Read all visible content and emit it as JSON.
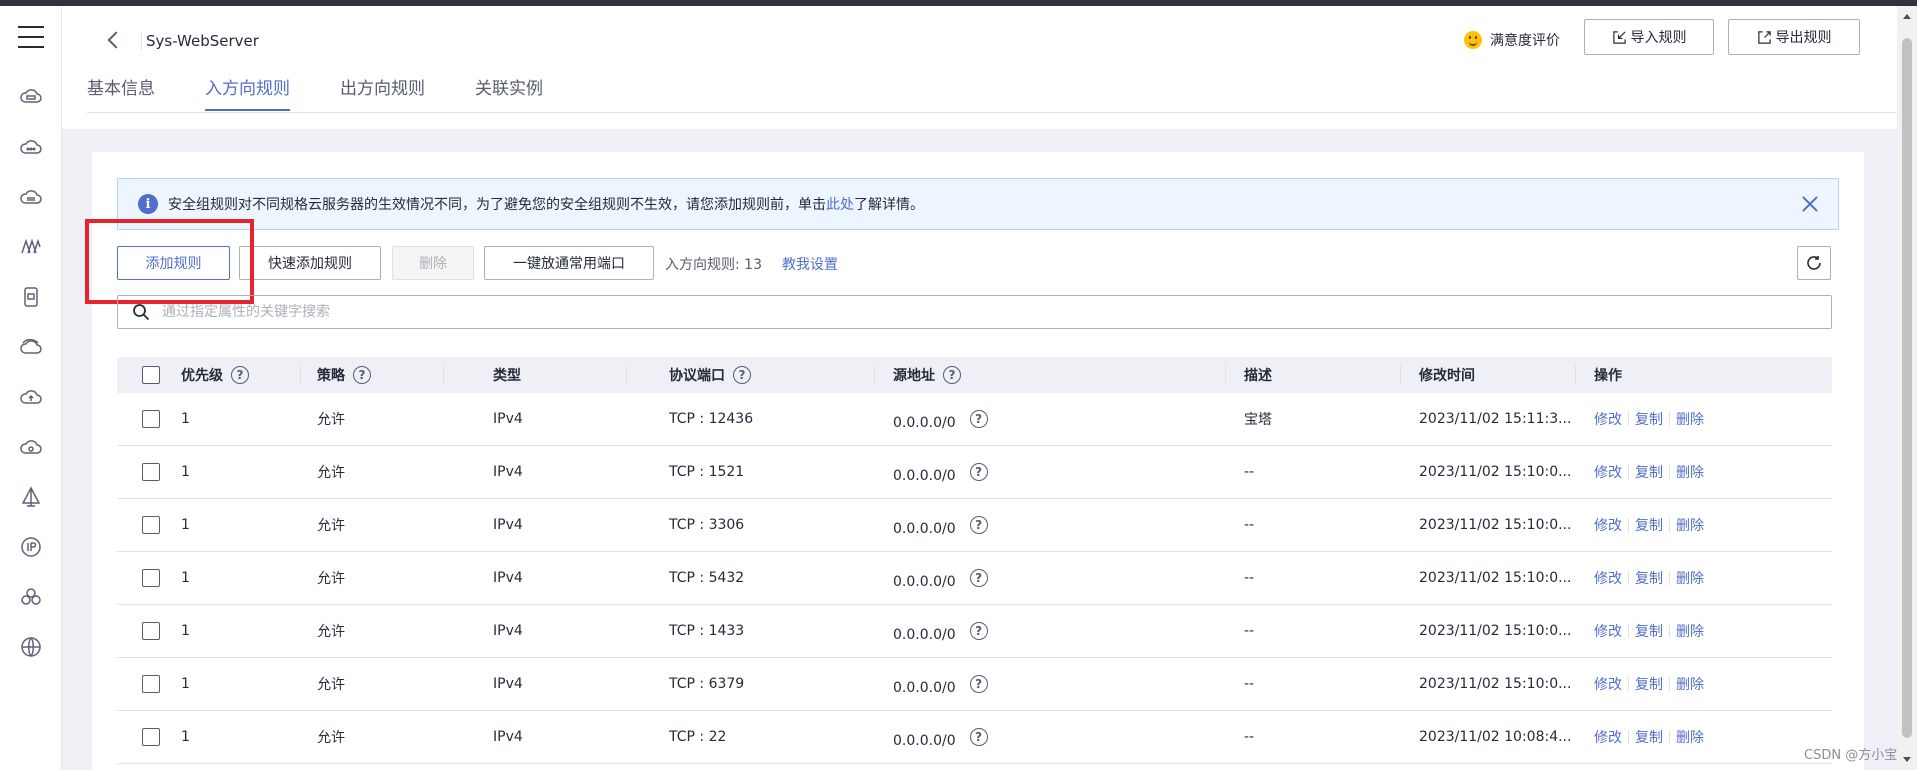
{
  "header": {
    "title": "Sys-WebServer",
    "satisfaction_label": "满意度评价",
    "import_label": "导入规则",
    "export_label": "导出规则"
  },
  "tabs": [
    {
      "label": "基本信息",
      "active": false
    },
    {
      "label": "入方向规则",
      "active": true
    },
    {
      "label": "出方向规则",
      "active": false
    },
    {
      "label": "关联实例",
      "active": false
    }
  ],
  "alert": {
    "text_before": "安全组规则对不同规格云服务器的生效情况不同，为了避免您的安全组规则不生效，请您添加规则前，单击",
    "link": "此处",
    "text_after": "了解详情。"
  },
  "toolbar": {
    "add_rule": "添加规则",
    "quick_add": "快速添加规则",
    "delete": "删除",
    "open_common_ports": "一键放通常用端口",
    "rule_count_label": "入方向规则: 13",
    "help_link": "教我设置"
  },
  "search": {
    "placeholder": "通过指定属性的关键字搜索"
  },
  "table": {
    "columns": {
      "priority": "优先级",
      "policy": "策略",
      "type": "类型",
      "protocol_port": "协议端口",
      "source": "源地址",
      "description": "描述",
      "modified": "修改时间",
      "actions": "操作"
    },
    "rows": [
      {
        "priority": "1",
        "policy": "允许",
        "type": "IPv4",
        "port": "TCP : 12436",
        "source": "0.0.0.0/0",
        "description": "宝塔",
        "modified": "2023/11/02 15:11:3..."
      },
      {
        "priority": "1",
        "policy": "允许",
        "type": "IPv4",
        "port": "TCP : 1521",
        "source": "0.0.0.0/0",
        "description": "--",
        "modified": "2023/11/02 15:10:0..."
      },
      {
        "priority": "1",
        "policy": "允许",
        "type": "IPv4",
        "port": "TCP : 3306",
        "source": "0.0.0.0/0",
        "description": "--",
        "modified": "2023/11/02 15:10:0..."
      },
      {
        "priority": "1",
        "policy": "允许",
        "type": "IPv4",
        "port": "TCP : 5432",
        "source": "0.0.0.0/0",
        "description": "--",
        "modified": "2023/11/02 15:10:0..."
      },
      {
        "priority": "1",
        "policy": "允许",
        "type": "IPv4",
        "port": "TCP : 1433",
        "source": "0.0.0.0/0",
        "description": "--",
        "modified": "2023/11/02 15:10:0..."
      },
      {
        "priority": "1",
        "policy": "允许",
        "type": "IPv4",
        "port": "TCP : 6379",
        "source": "0.0.0.0/0",
        "description": "--",
        "modified": "2023/11/02 15:10:0..."
      },
      {
        "priority": "1",
        "policy": "允许",
        "type": "IPv4",
        "port": "TCP : 22",
        "source": "0.0.0.0/0",
        "description": "--",
        "modified": "2023/11/02 10:08:4..."
      }
    ],
    "actions": {
      "edit": "修改",
      "copy": "复制",
      "delete": "删除"
    }
  },
  "sidebar_icons": [
    "cloud-server-icon",
    "cloud-icon",
    "storage-icon",
    "network-icon",
    "device-icon",
    "cloud-sync-icon",
    "cloud-upload-icon",
    "cloud-settings-icon",
    "tent-icon",
    "ip-icon",
    "cluster-icon",
    "globe-icon"
  ],
  "watermark": "CSDN @方小宝"
}
